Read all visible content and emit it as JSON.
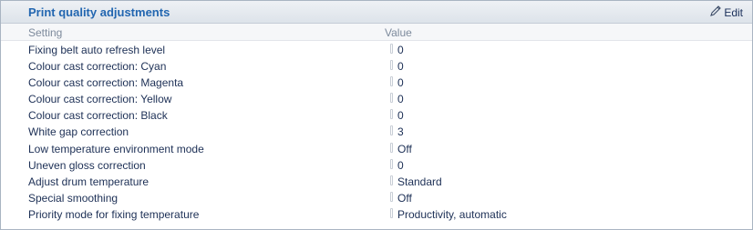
{
  "panel": {
    "title": "Print quality adjustments",
    "edit_label": "Edit"
  },
  "columns": {
    "setting": "Setting",
    "value": "Value"
  },
  "rows": [
    {
      "setting": "Fixing belt auto refresh level",
      "value": "0"
    },
    {
      "setting": "Colour cast correction: Cyan",
      "value": "0"
    },
    {
      "setting": "Colour cast correction: Magenta",
      "value": "0"
    },
    {
      "setting": "Colour cast correction: Yellow",
      "value": "0"
    },
    {
      "setting": "Colour cast correction: Black",
      "value": "0"
    },
    {
      "setting": "White gap correction",
      "value": "3"
    },
    {
      "setting": "Low temperature environment mode",
      "value": "Off"
    },
    {
      "setting": "Uneven gloss correction",
      "value": "0"
    },
    {
      "setting": "Adjust drum temperature",
      "value": "Standard"
    },
    {
      "setting": "Special smoothing",
      "value": "Off"
    },
    {
      "setting": "Priority mode for fixing temperature",
      "value": "Productivity, automatic"
    }
  ],
  "colors": {
    "title": "#2266b0",
    "text": "#1c2f55",
    "column_header": "#7d8a9c"
  },
  "icons": {
    "edit": "pencil-icon"
  }
}
